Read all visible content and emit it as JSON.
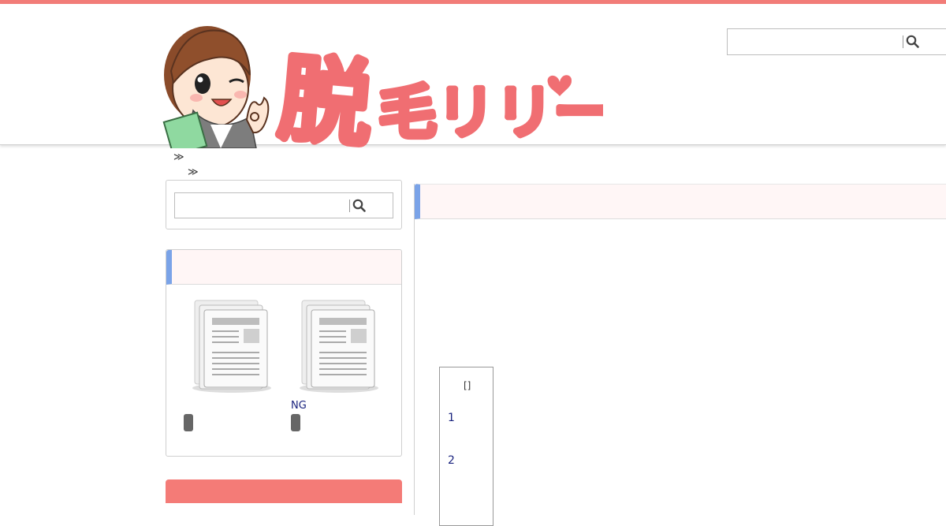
{
  "site": {
    "logo_text": "脱毛リリー",
    "accent_color": "#f27c78",
    "heading_accent": "#7aa3e8"
  },
  "header": {
    "search": {
      "placeholder": "",
      "icon": "search-icon"
    }
  },
  "breadcrumb": {
    "sep1": "≫",
    "sep2": "≫"
  },
  "sidebar": {
    "search": {
      "placeholder": "",
      "icon": "search-icon"
    },
    "widget": {
      "title": "",
      "posts": [
        {
          "title": "",
          "thumb_icon": "document-icon"
        },
        {
          "title": "NG",
          "thumb_icon": "document-icon"
        }
      ]
    }
  },
  "main": {
    "heading": "",
    "toc": {
      "title": "[]",
      "items": [
        "1",
        "2"
      ]
    }
  }
}
